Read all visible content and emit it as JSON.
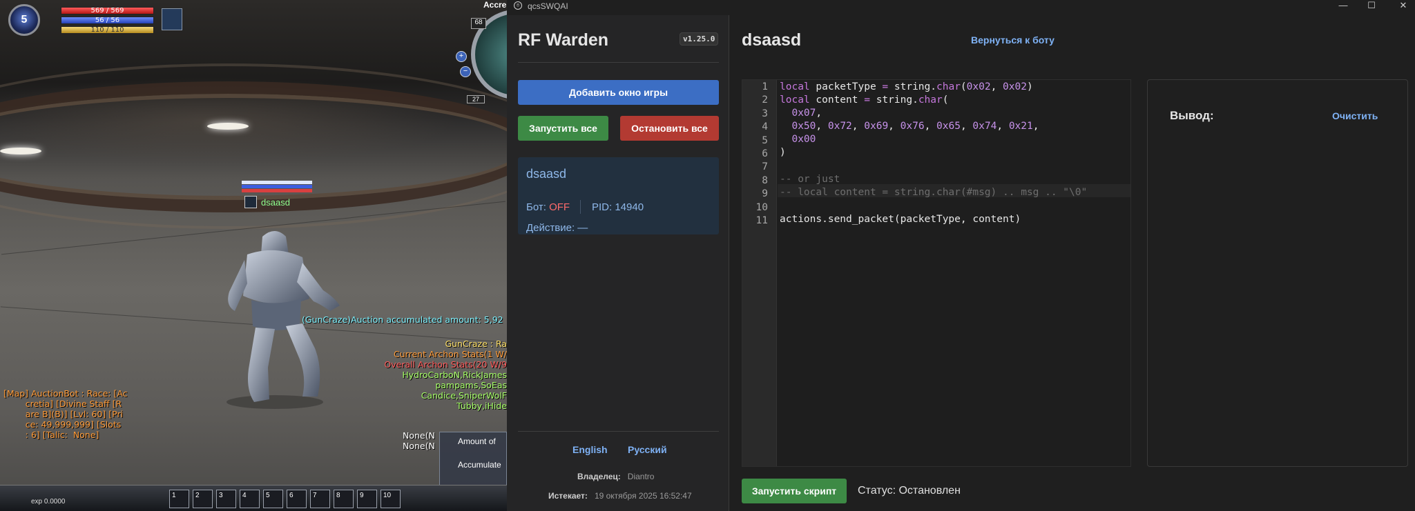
{
  "game": {
    "level": "5",
    "hp": "569 / 569",
    "fp": "56 / 56",
    "sp": "110 / 110",
    "minimap_label": "Accre",
    "minimap_value": "68",
    "minimap_small": "27",
    "character_name": "dsaasd",
    "chat": {
      "auction": "(GunCraze)Auction accumulated amount: 5,92",
      "lines": [
        {
          "text": "GunCraze : Ra",
          "cls": "yellow"
        },
        {
          "text": "Current Archon Stats(1 W/",
          "cls": "orange"
        },
        {
          "text": "Overall Archon Stats(20 W/9",
          "cls": "red"
        },
        {
          "text": "HydroCarboN,RickJames",
          "cls": "green"
        },
        {
          "text": "pampams,SoEas",
          "cls": "green"
        },
        {
          "text": "Candice,SniperWolF",
          "cls": "green"
        },
        {
          "text": "Tubby,iHide",
          "cls": "green"
        }
      ],
      "map_lines": [
        "[Map] AuctionBot : Race: [Ac",
        "        cretia] [Divine Staff [R",
        "        are B](B)] [Lvl: 60] [Pri",
        "        ce: 49,999,999] [Slots",
        "        : 6] [Talic:  None]"
      ],
      "none_lines": [
        "None(N",
        "None(N"
      ]
    },
    "panel_lines": [
      "Amount of",
      "Accumulate"
    ],
    "exp": "exp 0.0000",
    "slots": [
      "1",
      "2",
      "3",
      "4",
      "5",
      "6",
      "7",
      "8",
      "9",
      "10"
    ]
  },
  "window": {
    "title": "qcsSWQAI",
    "controls": [
      "—",
      "☐",
      "✕"
    ]
  },
  "sidebar": {
    "brand": "RF Warden",
    "version": "v1.25.0",
    "add_window": "Добавить окно игры",
    "start_all": "Запустить все",
    "stop_all": "Остановить все",
    "card": {
      "name": "dsaasd",
      "bot_label": "Бот:",
      "bot_state": "OFF",
      "pid": "PID: 14940",
      "action_label": "Действие: —"
    },
    "lang_en": "English",
    "lang_ru": "Русский",
    "owner_label": "Владелец:",
    "owner_value": "Diantro",
    "expires_label": "Истекает:",
    "expires_value": "19 октября 2025 16:52:47"
  },
  "main": {
    "title": "dsaasd",
    "back_link": "Вернуться к боту",
    "output_label": "Вывод:",
    "clear": "Очистить",
    "run_script": "Запустить скрипт",
    "status": "Статус: Остановлен"
  },
  "code": {
    "line_numbers": [
      "1",
      "2",
      "3",
      "4",
      "5",
      "6",
      "7",
      "8",
      "9",
      "10",
      "11"
    ]
  },
  "colors": {
    "accent_blue": "#3c6ec4",
    "accent_green": "#3d8a45",
    "accent_red": "#b33a32",
    "link": "#7fb2f5"
  }
}
